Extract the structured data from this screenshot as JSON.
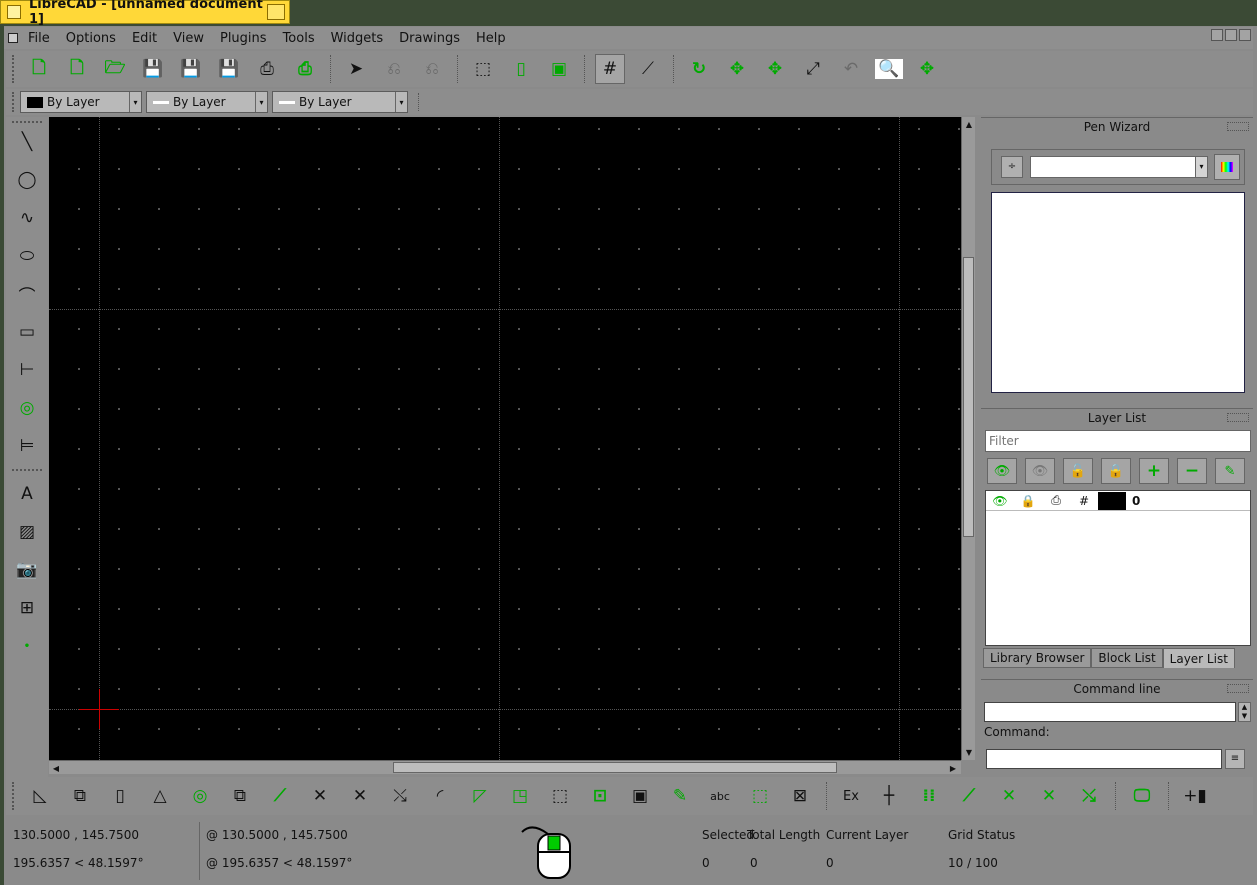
{
  "window_tab": {
    "title": "LibreCAD - [unnamed document 1]"
  },
  "menu": [
    "File",
    "Options",
    "Edit",
    "View",
    "Plugins",
    "Tools",
    "Widgets",
    "Drawings",
    "Help"
  ],
  "toolbar_main": [
    {
      "icon": "new-file-icon"
    },
    {
      "icon": "new-from-template-icon"
    },
    {
      "icon": "open-folder-icon"
    },
    {
      "icon": "save-icon"
    },
    {
      "icon": "save-as-icon"
    },
    {
      "icon": "save-all-icon"
    },
    {
      "icon": "print-icon"
    },
    {
      "icon": "print-preview-icon"
    },
    {
      "icon": "select-pointer-icon"
    },
    {
      "icon": "undo-icon"
    },
    {
      "icon": "redo-icon"
    },
    {
      "icon": "cut-icon"
    },
    {
      "icon": "copy-icon"
    },
    {
      "icon": "paste-icon"
    },
    {
      "icon": "grid-icon"
    },
    {
      "icon": "ortho-draft-icon"
    },
    {
      "icon": "redraw-icon"
    },
    {
      "icon": "zoom-in-icon"
    },
    {
      "icon": "zoom-out-icon"
    },
    {
      "icon": "zoom-auto-icon"
    },
    {
      "icon": "zoom-previous-icon"
    },
    {
      "icon": "zoom-window-icon"
    },
    {
      "icon": "zoom-pan-icon"
    }
  ],
  "pen": {
    "color": "By Layer",
    "width": "By Layer",
    "linetype": "By Layer"
  },
  "left_tools": [
    "line-icon",
    "circle-icon",
    "curve-icon",
    "ellipse-icon",
    "polyline-icon",
    "select-icon",
    "dimension-icon",
    "modify-icon",
    "info-icon",
    "text-icon",
    "hatch-icon",
    "image-icon",
    "block-icon",
    "point-icon"
  ],
  "pen_wizard": {
    "title": "Pen Wizard",
    "combo_value": ""
  },
  "layer_list": {
    "title": "Layer List",
    "filter_placeholder": "Filter",
    "layers": [
      {
        "name": "0",
        "color": "#000000"
      }
    ]
  },
  "dock_tabs": [
    "Library Browser",
    "Block List",
    "Layer List"
  ],
  "command_line": {
    "title": "Command line",
    "label": "Command:",
    "history": "",
    "input": ""
  },
  "snap_tools": [
    "snap-free-icon",
    "snap-grid-icon",
    "snap-endpoint-icon",
    "snap-on-entity-icon",
    "snap-center-icon",
    "snap-middle-icon",
    "snap-distance-icon",
    "snap-intersection-icon",
    "snap-tangent-icon",
    "snap-perpendicular-icon",
    "snap-arc-icon",
    "snap-angle-icon",
    "snap-corner-icon",
    "snap-rect-icon",
    "snap-move-icon",
    "snap-rotate-icon",
    "snap-scale-icon",
    "snap-pen-icon",
    "snap-text-icon",
    "snap-box-icon",
    "snap-box2-icon",
    "Ex",
    "snap-cross-icon",
    "snap-dots-icon",
    "snap-node1-icon",
    "snap-node2-icon",
    "snap-node3-icon",
    "snap-node4-icon",
    "monitor-icon",
    "add-icon"
  ],
  "status": {
    "abs_coord": "130.5000 , 145.7500",
    "abs_polar": "195.6357 < 48.1597°",
    "rel_coord": "@  130.5000 , 145.7500",
    "rel_polar": "@  195.6357 < 48.1597°",
    "selected_label": "Selected",
    "selected_value": "0",
    "total_length_label": "Total Length",
    "total_length_value": "0",
    "current_layer_label": "Current Layer",
    "current_layer_value": "0",
    "grid_status_label": "Grid Status",
    "grid_status_value": "10 / 100"
  }
}
